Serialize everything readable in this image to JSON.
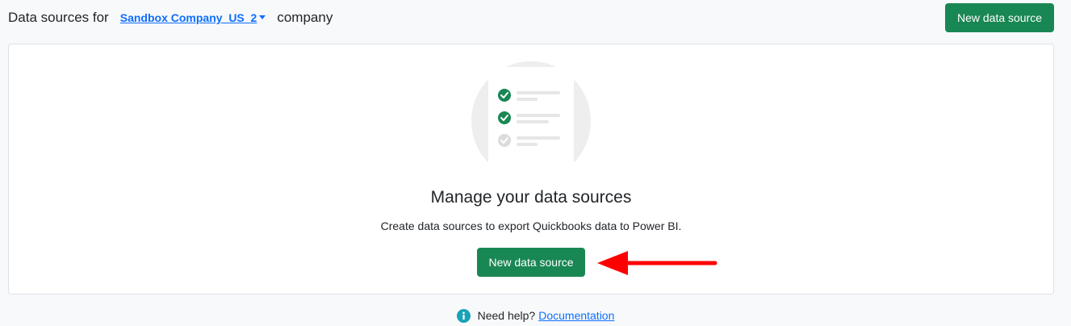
{
  "header": {
    "prefix": "Data sources for",
    "company_name": "Sandbox Company_US_2",
    "suffix": "company",
    "new_button_label": "New data source"
  },
  "empty_state": {
    "title": "Manage your data sources",
    "subtitle": "Create data sources to export Quickbooks data to Power BI.",
    "button_label": "New data source",
    "illustration_icons": [
      "check-icon",
      "check-icon",
      "check-icon-inactive"
    ]
  },
  "footer": {
    "help_text": "Need help?",
    "link_label": "Documentation"
  },
  "colors": {
    "primary_green": "#198754",
    "link_blue": "#0d6efd",
    "annotation_red": "#ff0000"
  }
}
